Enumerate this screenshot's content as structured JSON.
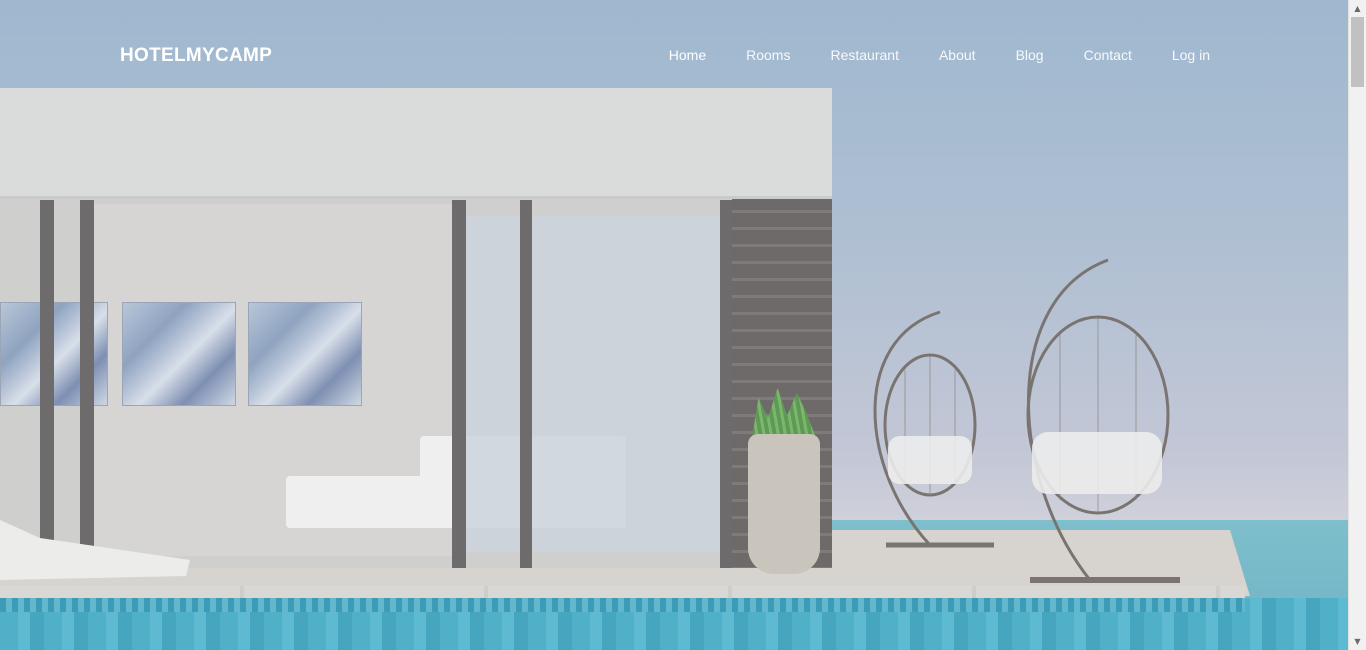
{
  "brand": {
    "name": "HOTELMYCAMP"
  },
  "nav": {
    "items": [
      {
        "label": "Home",
        "active": true
      },
      {
        "label": "Rooms"
      },
      {
        "label": "Restaurant"
      },
      {
        "label": "About"
      },
      {
        "label": "Blog"
      },
      {
        "label": "Contact"
      },
      {
        "label": "Log in"
      }
    ]
  },
  "scrollbar": {
    "up_icon": "▲",
    "down_icon": "▼"
  },
  "colors": {
    "nav_text": "#ffffff",
    "sky": "#a9bdd0",
    "pool": "#4fb0c8"
  }
}
